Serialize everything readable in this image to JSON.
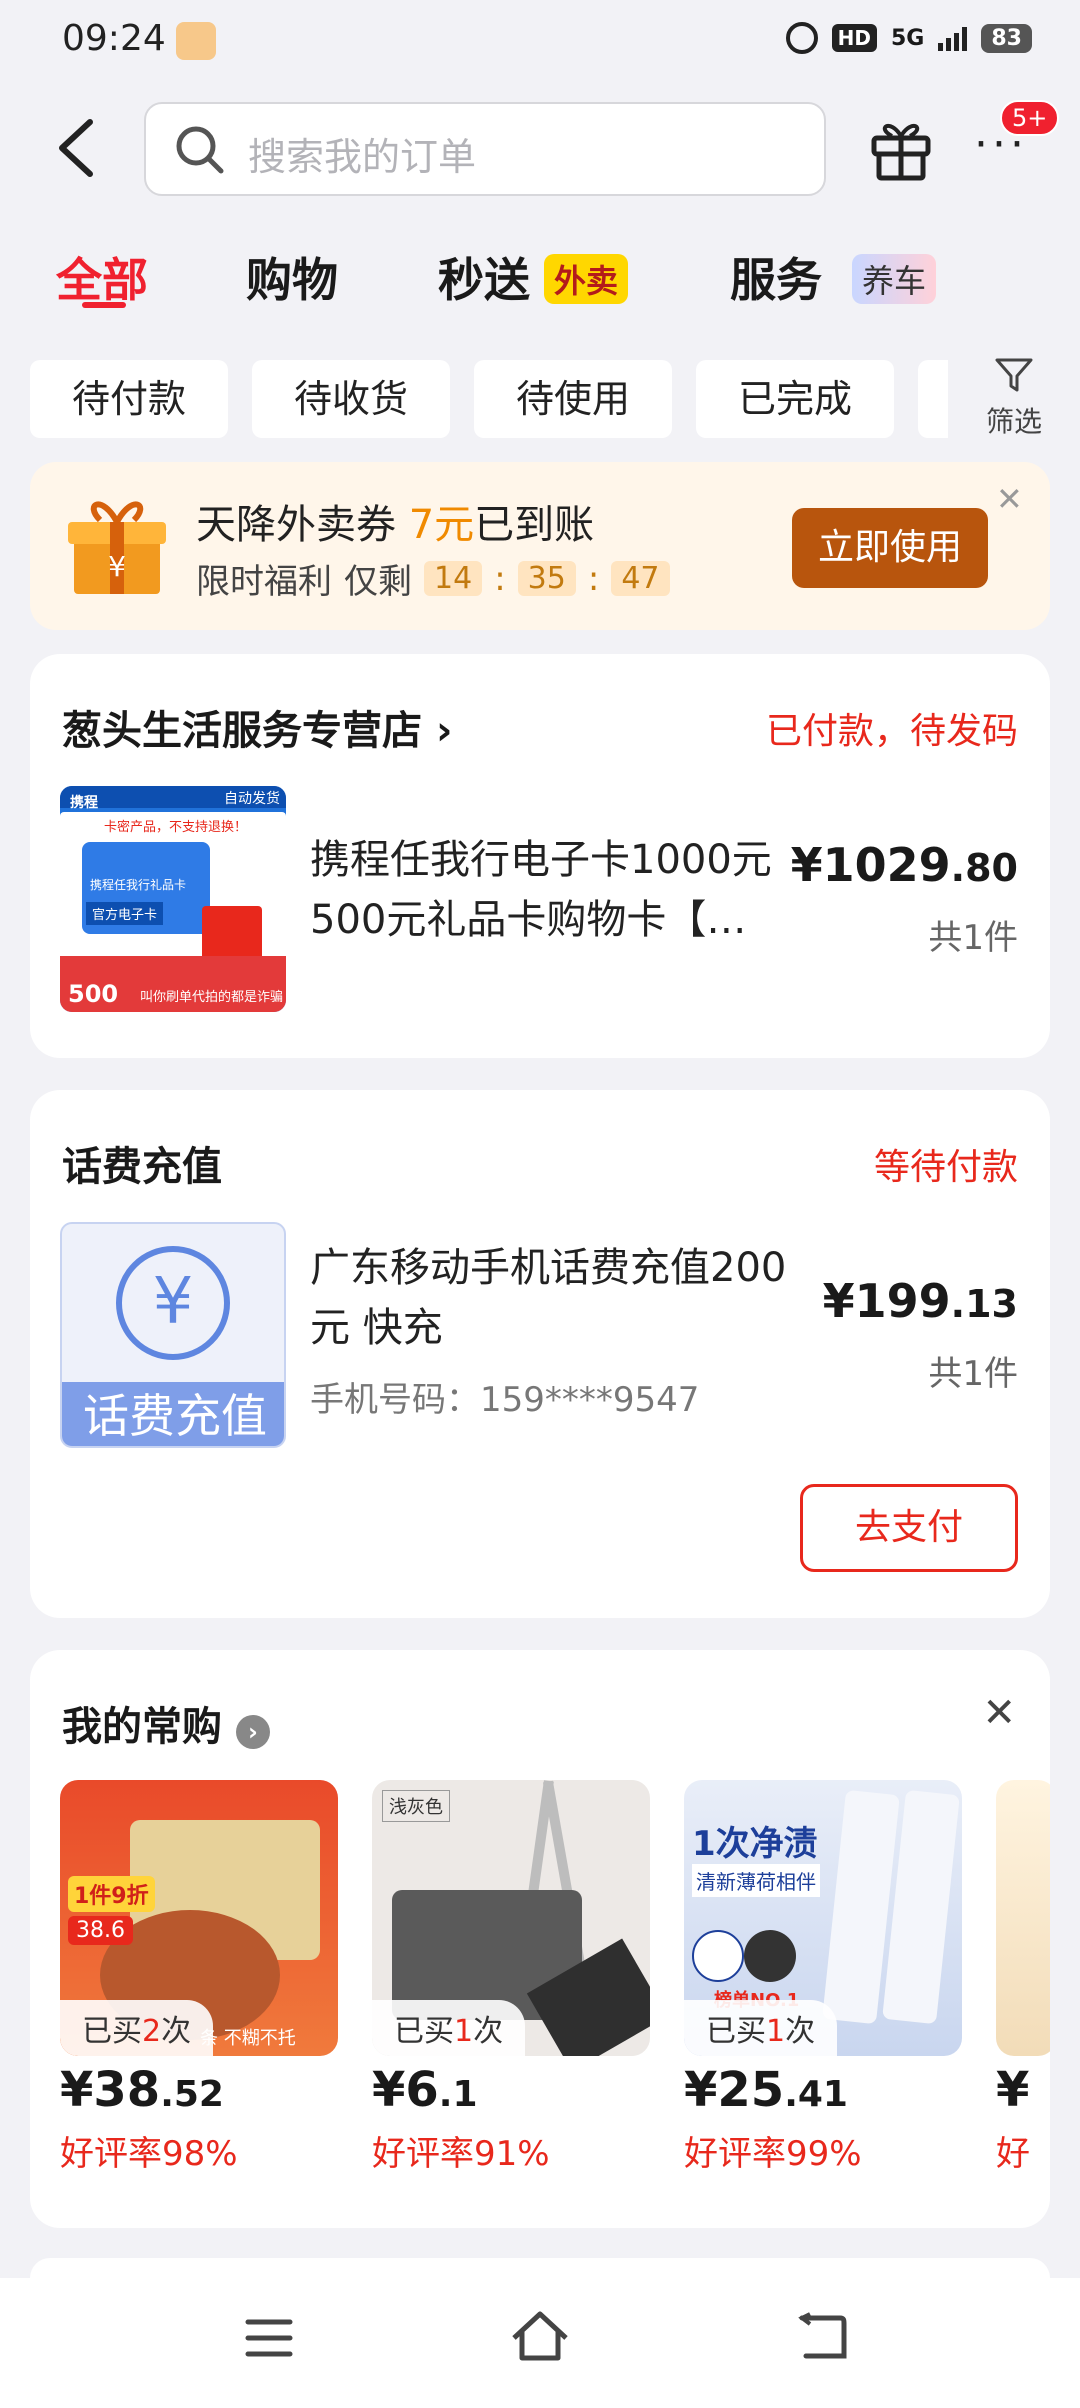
{
  "status_bar": {
    "time": "09:24",
    "hd": "HD",
    "network": "5G",
    "battery": "83"
  },
  "search": {
    "placeholder": "搜索我的订单"
  },
  "header": {
    "notification_badge": "5+"
  },
  "tabs": [
    {
      "label": "全部",
      "active": true
    },
    {
      "label": "购物"
    },
    {
      "label": "秒送",
      "tag": "外卖"
    },
    {
      "label": "服务",
      "tag": "养车"
    }
  ],
  "filters": [
    "待付款",
    "待收货",
    "待使用",
    "已完成"
  ],
  "filter_button": "筛选",
  "promo": {
    "title_prefix": "天降外卖券",
    "amount": "7元",
    "title_suffix": "已到账",
    "subtitle": "限时福利",
    "remain": "仅剩",
    "countdown": [
      "14",
      "35",
      "47"
    ],
    "button": "立即使用"
  },
  "orders": [
    {
      "shop": "葱头生活服务专营店",
      "status": "已付款，待发码",
      "title": "携程任我行电子卡1000元500元礼品卡购物卡【…",
      "price_int": "¥1029",
      "price_dec": ".80",
      "qty": "共1件",
      "thumb": {
        "tag": "自动发货",
        "top": "卡密产品，不支持退换！",
        "brand": "携程",
        "card": "携程任我行礼品卡",
        "label": "官方电子卡",
        "value": "500",
        "foot": "叫你刷单代拍的都是诈骗"
      }
    },
    {
      "shop": "话费充值",
      "status": "等待付款",
      "title": "广东移动手机话费充值200元 快充",
      "phone": "手机号码：159****9547",
      "price_int": "¥199",
      "price_dec": ".13",
      "qty": "共1件",
      "action": "去支付",
      "thumb": {
        "symbol": "¥",
        "label": "话费充值"
      }
    }
  ],
  "frequent": {
    "title": "我的常购",
    "items": [
      {
        "bought_prefix": "已买",
        "count": "2",
        "bought_suffix": "次",
        "price_int": "¥38",
        "price_dec": ".52",
        "rating": "好评率98%"
      },
      {
        "bought_prefix": "已买",
        "count": "1",
        "bought_suffix": "次",
        "price_int": "¥6",
        "price_dec": ".1",
        "rating": "好评率91%"
      },
      {
        "bought_prefix": "已买",
        "count": "1",
        "bought_suffix": "次",
        "price_int": "¥25",
        "price_dec": ".41",
        "rating": "好评率99%"
      }
    ],
    "item1_img": {
      "badge": "1件9折",
      "price": "38.6",
      "foot": "条 不糊不托"
    },
    "item2_img": {
      "tag": "浅灰色"
    },
    "item3_img": {
      "headline": "1次净渍",
      "sub": "清新薄荷相伴",
      "rank": "榜单NO.1"
    }
  },
  "colors": {
    "accent": "#f0212f",
    "price_red": "#e8281c",
    "promo_btn": "#b8550d"
  }
}
